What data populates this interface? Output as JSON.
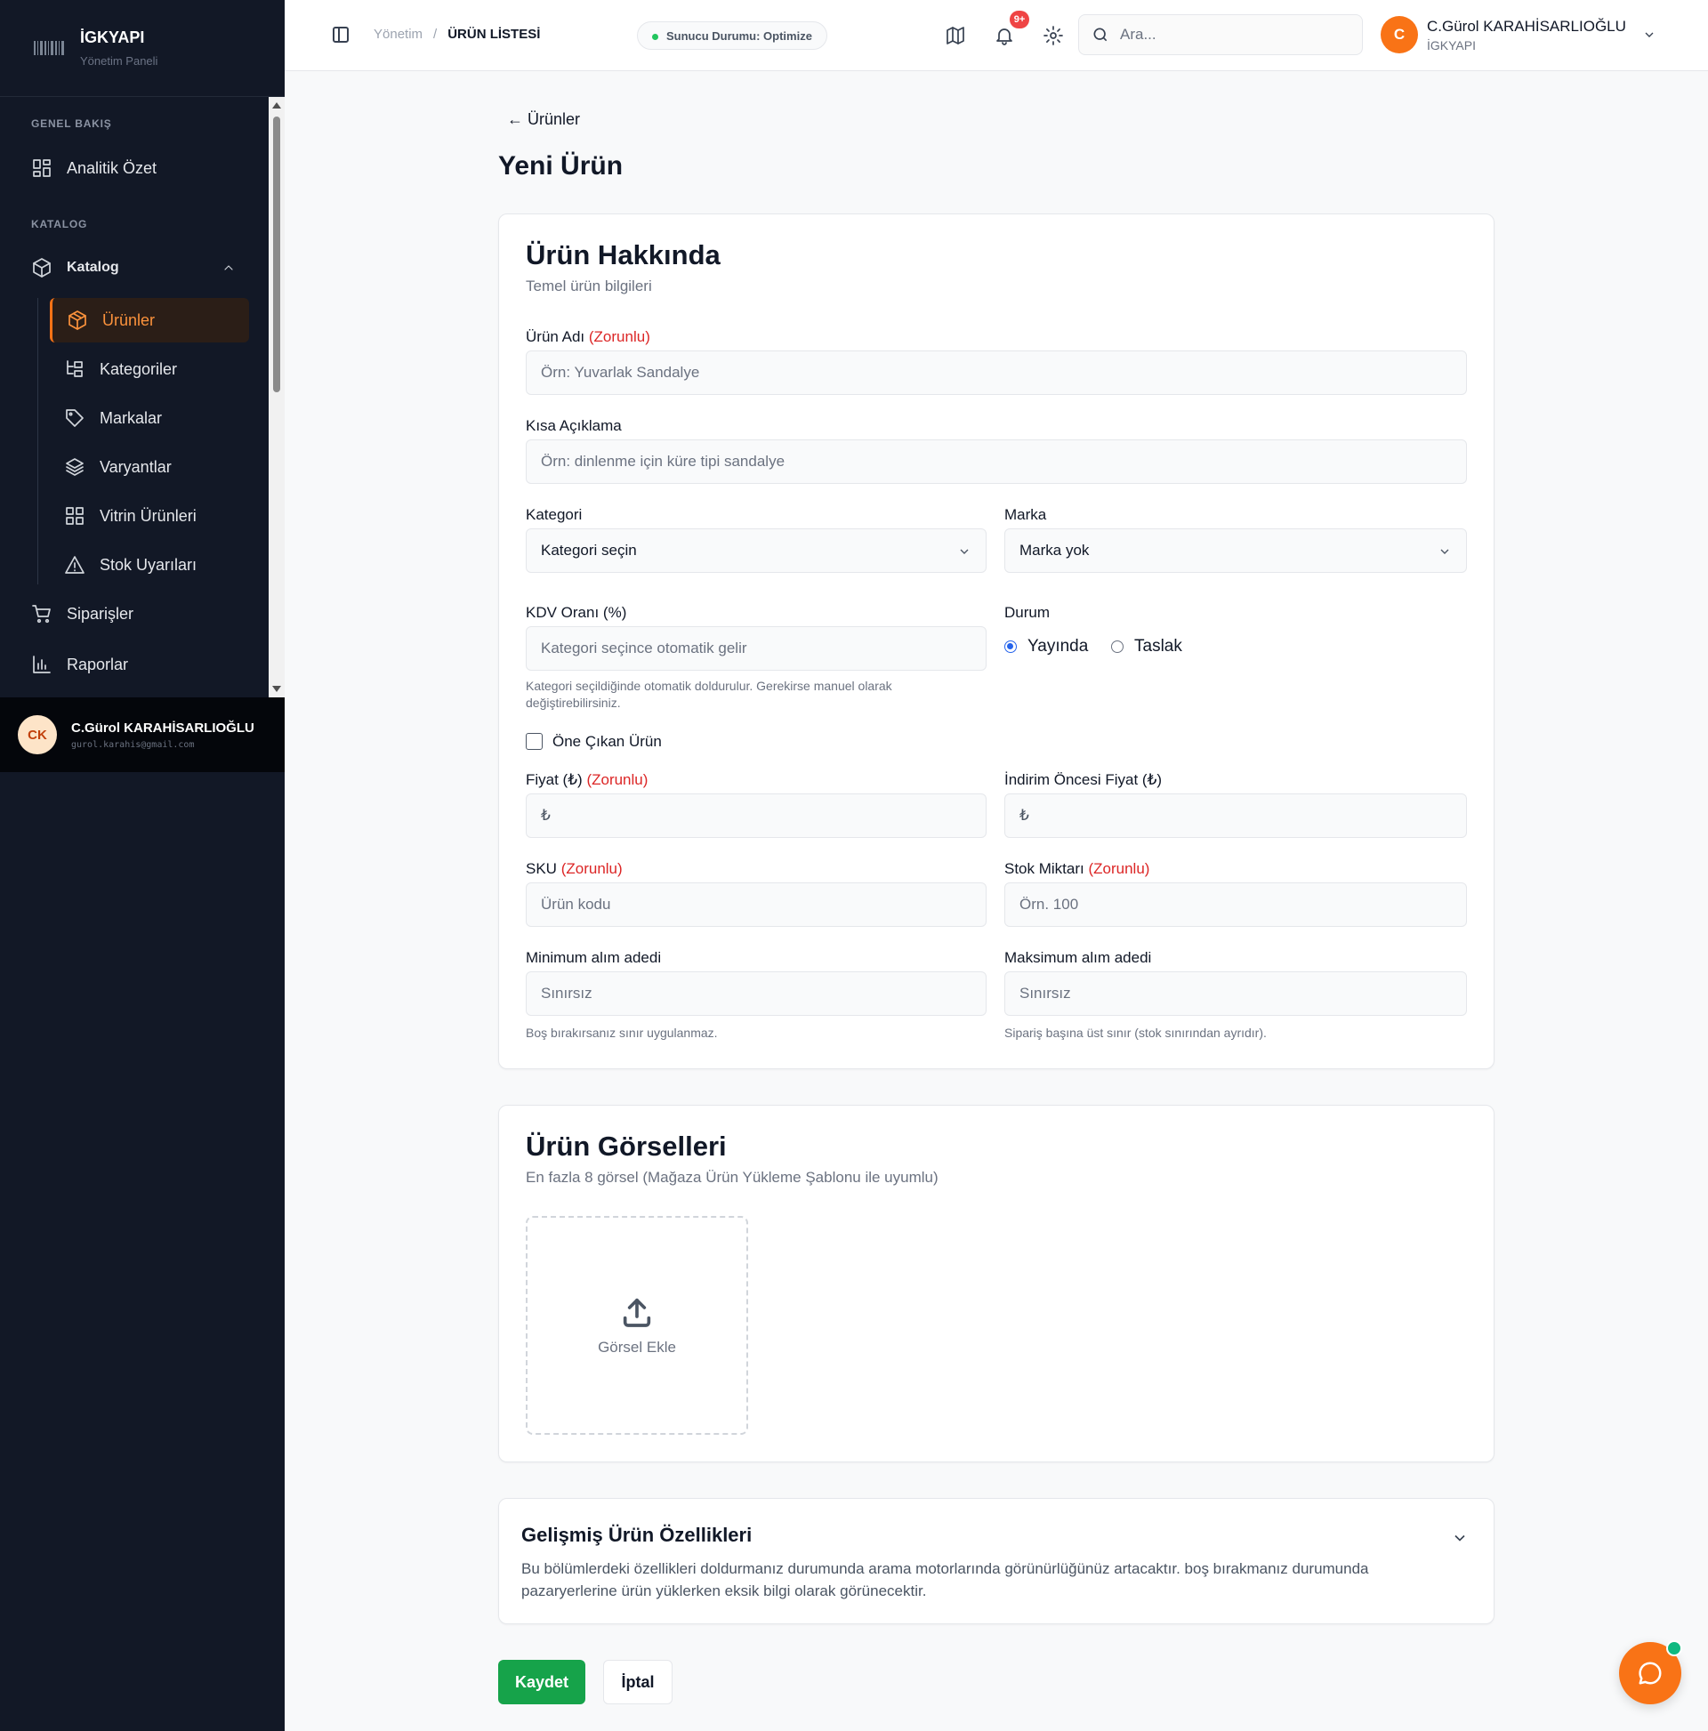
{
  "brand": {
    "name": "İGKYAPI",
    "subtitle": "Yönetim Paneli"
  },
  "sidebar": {
    "section_overview": "GENEL BAKIŞ",
    "analytics": "Analitik Özet",
    "section_catalog": "KATALOG",
    "catalog": "Katalog",
    "sub_items": [
      {
        "label": "Ürünler",
        "icon": "box-icon",
        "active": true
      },
      {
        "label": "Kategoriler",
        "icon": "hierarchy-icon"
      },
      {
        "label": "Markalar",
        "icon": "tag-icon"
      },
      {
        "label": "Varyantlar",
        "icon": "layers-icon"
      },
      {
        "label": "Vitrin Ürünleri",
        "icon": "grid-icon"
      },
      {
        "label": "Stok Uyarıları",
        "icon": "warning-icon"
      }
    ],
    "orders": "Siparişler",
    "reports": "Raporlar",
    "user": {
      "initials": "CK",
      "name": "C.Gürol KARAHİSARLIOĞLU",
      "email": "gurol.karahis@gmail.com"
    }
  },
  "header": {
    "breadcrumb": {
      "root": "Yönetim",
      "separator": "/",
      "current": "ÜRÜN LİSTESİ"
    },
    "status": "Sunucu Durumu: Optimize",
    "notifications_badge": "9+",
    "search_placeholder": "Ara...",
    "user": {
      "initial": "C",
      "name": "C.Gürol KARAHİSARLIOĞLU",
      "org": "İGKYAPI"
    }
  },
  "page": {
    "back_link": "← Ürünler",
    "title": "Yeni Ürün"
  },
  "about": {
    "title": "Ürün Hakkında",
    "subtitle": "Temel ürün bilgileri",
    "required_tag": "(Zorunlu)",
    "product_name_label": "Ürün Adı",
    "product_name_placeholder": "Örn: Yuvarlak Sandalye",
    "short_desc_label": "Kısa Açıklama",
    "short_desc_placeholder": "Örn: dinlenme için küre tipi sandalye",
    "category_label": "Kategori",
    "category_value": "Kategori seçin",
    "brand_label": "Marka",
    "brand_value": "Marka yok",
    "vat_label": "KDV Oranı (%)",
    "vat_placeholder": "Kategori seçince otomatik gelir",
    "vat_hint": "Kategori seçildiğinde otomatik doldurulur. Gerekirse manuel olarak değiştirebilirsiniz.",
    "status_label": "Durum",
    "status_options": [
      "Yayında",
      "Taslak"
    ],
    "status_selected": "Yayında",
    "featured_label": "Öne Çıkan Ürün",
    "price_label": "Fiyat (₺)",
    "price_prefix": "₺",
    "old_price_label": "İndirim Öncesi Fiyat (₺)",
    "sku_label": "SKU",
    "sku_placeholder": "Ürün kodu",
    "stock_label": "Stok Miktarı",
    "stock_placeholder": "Örn. 100",
    "min_label": "Minimum alım adedi",
    "min_placeholder": "Sınırsız",
    "min_hint": "Boş bırakırsanız sınır uygulanmaz.",
    "max_label": "Maksimum alım adedi",
    "max_placeholder": "Sınırsız",
    "max_hint": "Sipariş başına üst sınır (stok sınırından ayrıdır)."
  },
  "images": {
    "title": "Ürün Görselleri",
    "subtitle": "En fazla 8 görsel (Mağaza Ürün Yükleme Şablonu ile uyumlu)",
    "add_label": "Görsel Ekle"
  },
  "advanced": {
    "title": "Gelişmiş Ürün Özellikleri",
    "description": "Bu bölümlerdeki özellikleri doldurmanız durumunda arama motorlarında görünürlüğünüz artacaktır. boş bırakmanız durumunda pazaryerlerine ürün yüklerken eksik bilgi olarak görünecektir."
  },
  "actions": {
    "save": "Kaydet",
    "cancel": "İptal"
  },
  "colors": {
    "accent": "#f97316",
    "sidebar_bg": "#121826",
    "save": "#16a34a",
    "required": "#dc2626",
    "radio": "#2563eb"
  }
}
